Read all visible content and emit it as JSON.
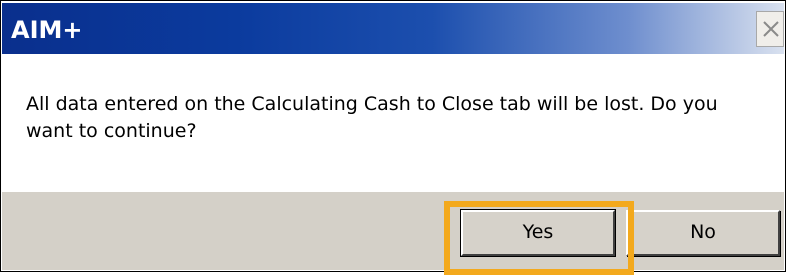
{
  "window": {
    "title": "AIM+"
  },
  "dialog": {
    "message": "All data entered on the Calculating Cash to Close tab will be lost. Do you want to continue?",
    "yes_label": "Yes",
    "no_label": "No"
  },
  "icons": {
    "close": "close-icon"
  },
  "colors": {
    "titlebar_start": "#0a2f8d",
    "titlebar_end": "#d9e1ef",
    "button_bar": "#d4d0c8",
    "highlight": "#f3a91d"
  }
}
